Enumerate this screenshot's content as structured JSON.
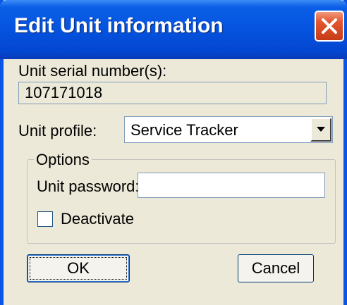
{
  "window": {
    "title": "Edit Unit information",
    "close_icon": "close-icon"
  },
  "form": {
    "serial_label": "Unit serial number(s):",
    "serial_value": "107171018",
    "profile_label": "Unit profile:",
    "profile_selected": "Service Tracker",
    "options_legend": "Options",
    "password_label": "Unit password:",
    "password_value": "",
    "deactivate_label": "Deactivate",
    "deactivate_checked": false
  },
  "buttons": {
    "ok_label": "OK",
    "cancel_label": "Cancel"
  },
  "colors": {
    "title_bar": "#0553df",
    "close_button": "#e2572f",
    "dialog_background": "#ece9d8"
  }
}
